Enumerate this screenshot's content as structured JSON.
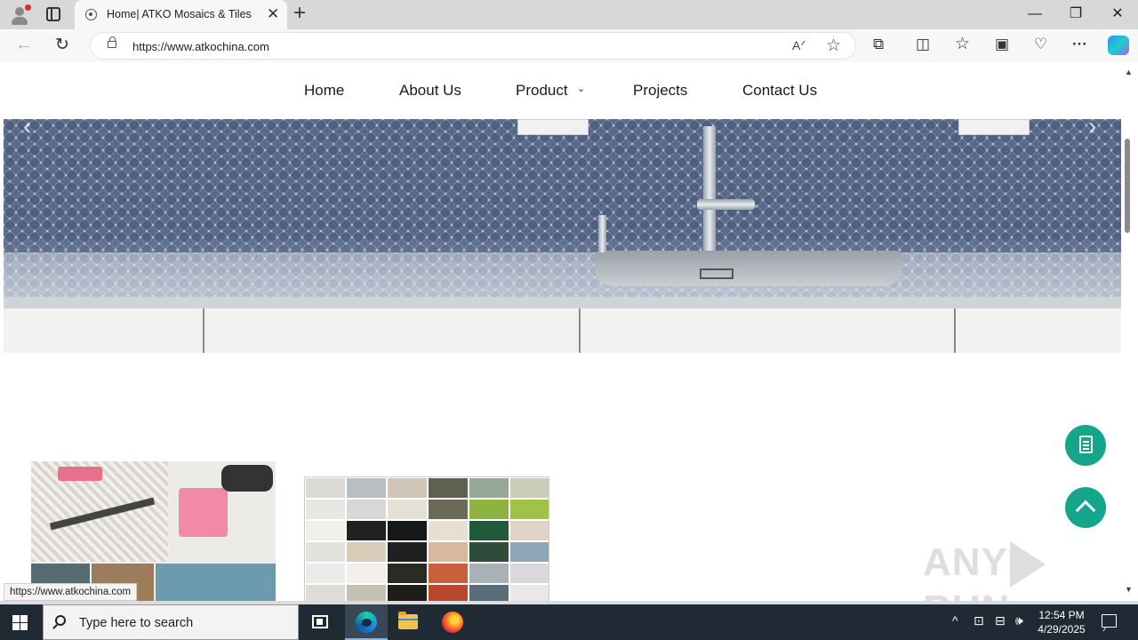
{
  "browser": {
    "tab_title": "Home| ATKO Mosaics & Tiles",
    "tab_close": "✕",
    "new_tab": "+",
    "window": {
      "minimize": "—",
      "restore": "❐",
      "close": "✕"
    },
    "nav": {
      "back": "←",
      "reload": "↻"
    },
    "url": "https://www.atkochina.com",
    "read_aloud": "Aᐟ",
    "favorite": "☆",
    "toolbar_icons": {
      "extensions": "⧉",
      "split": "◫",
      "favorites": "☆",
      "collections": "▣",
      "performance": "♡",
      "menu": "···"
    }
  },
  "site": {
    "nav": {
      "home": "Home",
      "about": "About Us",
      "product": "Product",
      "product_chevron": "⌄",
      "projects": "Projects",
      "contact": "Contact Us"
    },
    "hero_arrows": {
      "prev": "‹",
      "next": "›"
    },
    "watermark": {
      "left": "ANY",
      "right": "RUN"
    }
  },
  "status_bar_url": "https://www.atkochina.com",
  "scrollbar": {
    "up": "▲",
    "down": "▼"
  },
  "taskbar": {
    "search_placeholder": "Type here to search",
    "tray": {
      "chevron": "^",
      "wifi_box": "⊡",
      "network": "⊟",
      "volume": "🕪"
    },
    "time": "12:54 PM",
    "date": "4/29/2025"
  },
  "colors": {
    "accent_green": "#13a68a",
    "taskbar_bg": "#1f2a35",
    "tiles_dark": "#4f5f7f"
  }
}
